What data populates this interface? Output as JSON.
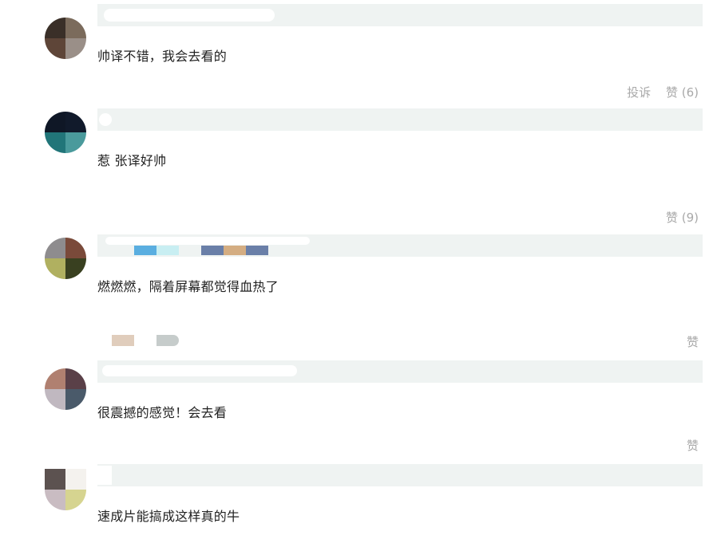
{
  "comments": [
    {
      "text": "帅译不错，我会去看的",
      "report_label": "投诉",
      "like_label": "赞 (6)",
      "avatar_colors": [
        "#3a2f28",
        "#7b6b5c",
        "#5e4538",
        "#9a8f88"
      ]
    },
    {
      "text": "惹 张译好帅",
      "like_label": "赞 (9)",
      "avatar_colors": [
        "#0f1726",
        "#111a2b",
        "#217579",
        "#4a9a9c"
      ]
    },
    {
      "text": "燃燃燃，隔着屏幕都觉得血热了",
      "like_label": "赞",
      "avatar_colors": [
        "#8e8c8e",
        "#7a4a3a",
        "#b0b060",
        "#394020"
      ],
      "name_swatches": [
        "#5aaee0",
        "#c8eef2",
        "#6a7fa8",
        "#d4ad82",
        "#6a7fa8"
      ]
    },
    {
      "text": "很震撼的感觉！会去看",
      "like_label": "赞",
      "avatar_colors": [
        "#b08070",
        "#5a4048",
        "#c0b8c0",
        "#4a5a6a"
      ]
    },
    {
      "text": "速成片能搞成这样真的牛",
      "avatar_colors": [
        "#5c5250",
        "#f4f2ee",
        "#c9bcc2",
        "#d6d490"
      ]
    }
  ]
}
